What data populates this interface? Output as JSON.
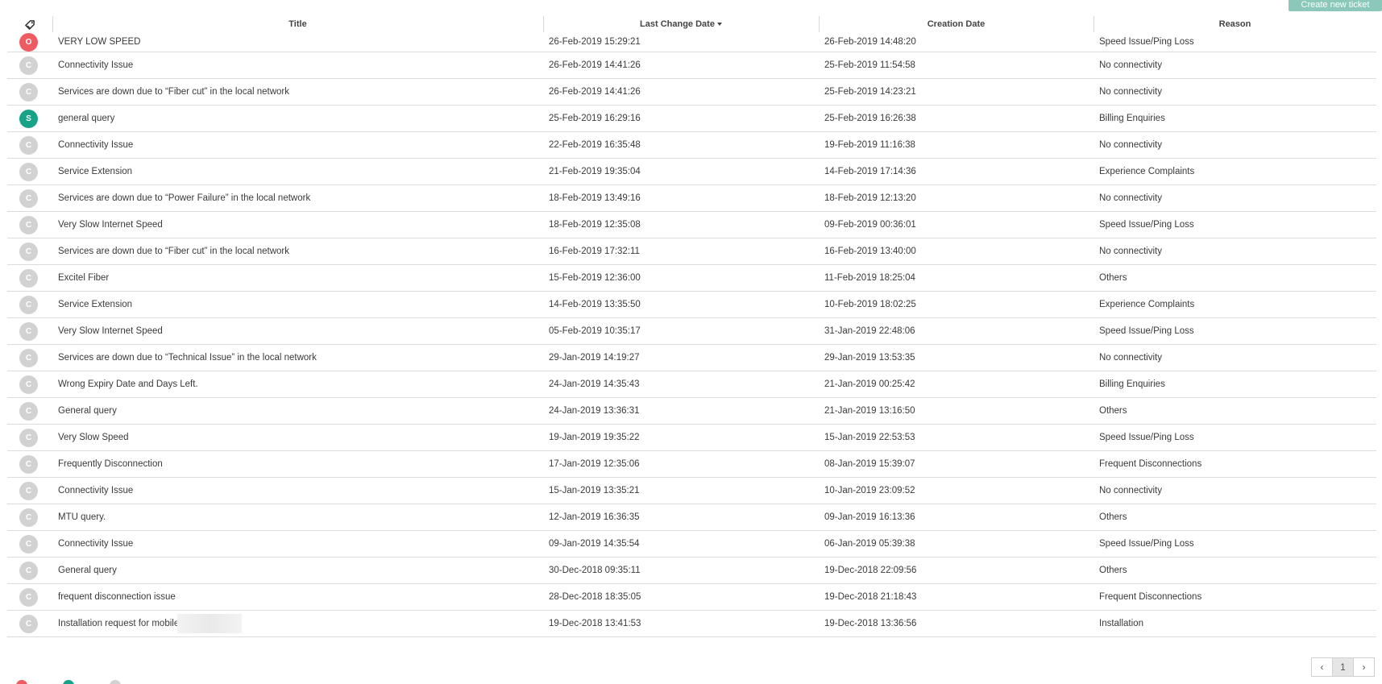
{
  "toolbar": {
    "create_label": "Create new ticket"
  },
  "table": {
    "headers": {
      "title": "Title",
      "last_change": "Last Change Date",
      "creation": "Creation Date",
      "reason": "Reason"
    },
    "rows": [
      {
        "status": "O",
        "status_type": "open",
        "title": "VERY LOW SPEED",
        "last_change": "26-Feb-2019 15:29:21",
        "creation": "26-Feb-2019 14:48:20",
        "reason": "Speed Issue/Ping Loss"
      },
      {
        "status": "C",
        "status_type": "closed",
        "title": "Connectivity Issue",
        "last_change": "26-Feb-2019 14:41:26",
        "creation": "25-Feb-2019 11:54:58",
        "reason": "No connectivity"
      },
      {
        "status": "C",
        "status_type": "closed",
        "title": "Services are down due to “Fiber cut” in the local network",
        "last_change": "26-Feb-2019 14:41:26",
        "creation": "25-Feb-2019 14:23:21",
        "reason": "No connectivity"
      },
      {
        "status": "S",
        "status_type": "solved",
        "title": "general query",
        "last_change": "25-Feb-2019 16:29:16",
        "creation": "25-Feb-2019 16:26:38",
        "reason": "Billing Enquiries"
      },
      {
        "status": "C",
        "status_type": "closed",
        "title": "Connectivity Issue",
        "last_change": "22-Feb-2019 16:35:48",
        "creation": "19-Feb-2019 11:16:38",
        "reason": "No connectivity"
      },
      {
        "status": "C",
        "status_type": "closed",
        "title": "Service Extension",
        "last_change": "21-Feb-2019 19:35:04",
        "creation": "14-Feb-2019 17:14:36",
        "reason": "Experience Complaints"
      },
      {
        "status": "C",
        "status_type": "closed",
        "title": "Services are down due to “Power Failure” in the local network",
        "last_change": "18-Feb-2019 13:49:16",
        "creation": "18-Feb-2019 12:13:20",
        "reason": "No connectivity"
      },
      {
        "status": "C",
        "status_type": "closed",
        "title": "Very Slow Internet Speed",
        "last_change": "18-Feb-2019 12:35:08",
        "creation": "09-Feb-2019 00:36:01",
        "reason": "Speed Issue/Ping Loss"
      },
      {
        "status": "C",
        "status_type": "closed",
        "title": "Services are down due to “Fiber cut” in the local network",
        "last_change": "16-Feb-2019 17:32:11",
        "creation": "16-Feb-2019 13:40:00",
        "reason": "No connectivity"
      },
      {
        "status": "C",
        "status_type": "closed",
        "title": "Excitel Fiber",
        "last_change": "15-Feb-2019 12:36:00",
        "creation": "11-Feb-2019 18:25:04",
        "reason": "Others"
      },
      {
        "status": "C",
        "status_type": "closed",
        "title": "Service Extension",
        "last_change": "14-Feb-2019 13:35:50",
        "creation": "10-Feb-2019 18:02:25",
        "reason": "Experience Complaints"
      },
      {
        "status": "C",
        "status_type": "closed",
        "title": "Very Slow Internet Speed",
        "last_change": "05-Feb-2019 10:35:17",
        "creation": "31-Jan-2019 22:48:06",
        "reason": "Speed Issue/Ping Loss"
      },
      {
        "status": "C",
        "status_type": "closed",
        "title": "Services are down due to “Technical Issue” in the local network",
        "last_change": "29-Jan-2019 14:19:27",
        "creation": "29-Jan-2019 13:53:35",
        "reason": "No connectivity"
      },
      {
        "status": "C",
        "status_type": "closed",
        "title": "Wrong Expiry Date and Days Left.",
        "last_change": "24-Jan-2019 14:35:43",
        "creation": "21-Jan-2019 00:25:42",
        "reason": "Billing Enquiries"
      },
      {
        "status": "C",
        "status_type": "closed",
        "title": "General query",
        "last_change": "24-Jan-2019 13:36:31",
        "creation": "21-Jan-2019 13:16:50",
        "reason": "Others"
      },
      {
        "status": "C",
        "status_type": "closed",
        "title": "Very Slow Speed",
        "last_change": "19-Jan-2019 19:35:22",
        "creation": "15-Jan-2019 22:53:53",
        "reason": "Speed Issue/Ping Loss"
      },
      {
        "status": "C",
        "status_type": "closed",
        "title": "Frequently Disconnection",
        "last_change": "17-Jan-2019 12:35:06",
        "creation": "08-Jan-2019 15:39:07",
        "reason": "Frequent Disconnections"
      },
      {
        "status": "C",
        "status_type": "closed",
        "title": "Connectivity Issue",
        "last_change": "15-Jan-2019 13:35:21",
        "creation": "10-Jan-2019 23:09:52",
        "reason": "No connectivity"
      },
      {
        "status": "C",
        "status_type": "closed",
        "title": "MTU query.",
        "last_change": "12-Jan-2019 16:36:35",
        "creation": "09-Jan-2019 16:13:36",
        "reason": "Others"
      },
      {
        "status": "C",
        "status_type": "closed",
        "title": "Connectivity Issue",
        "last_change": "09-Jan-2019 14:35:54",
        "creation": "06-Jan-2019 05:39:38",
        "reason": "Speed Issue/Ping Loss"
      },
      {
        "status": "C",
        "status_type": "closed",
        "title": "General query",
        "last_change": "30-Dec-2018 09:35:11",
        "creation": "19-Dec-2018 22:09:56",
        "reason": "Others"
      },
      {
        "status": "C",
        "status_type": "closed",
        "title": "frequent disconnection issue",
        "last_change": "28-Dec-2018 18:35:05",
        "creation": "19-Dec-2018 21:18:43",
        "reason": "Frequent Disconnections"
      },
      {
        "status": "C",
        "status_type": "closed",
        "title": "Installation request for mobile",
        "last_change": "19-Dec-2018 13:41:53",
        "creation": "19-Dec-2018 13:36:56",
        "reason": "Installation",
        "redacted": true
      }
    ]
  },
  "pagination": {
    "prev": "‹",
    "current": "1",
    "next": "›"
  },
  "colors": {
    "open": "#ef5b63",
    "solved": "#18a389",
    "closed": "#d2d2d2",
    "button": "#8cc8b9"
  },
  "icons": {
    "header": "tag-icon"
  }
}
